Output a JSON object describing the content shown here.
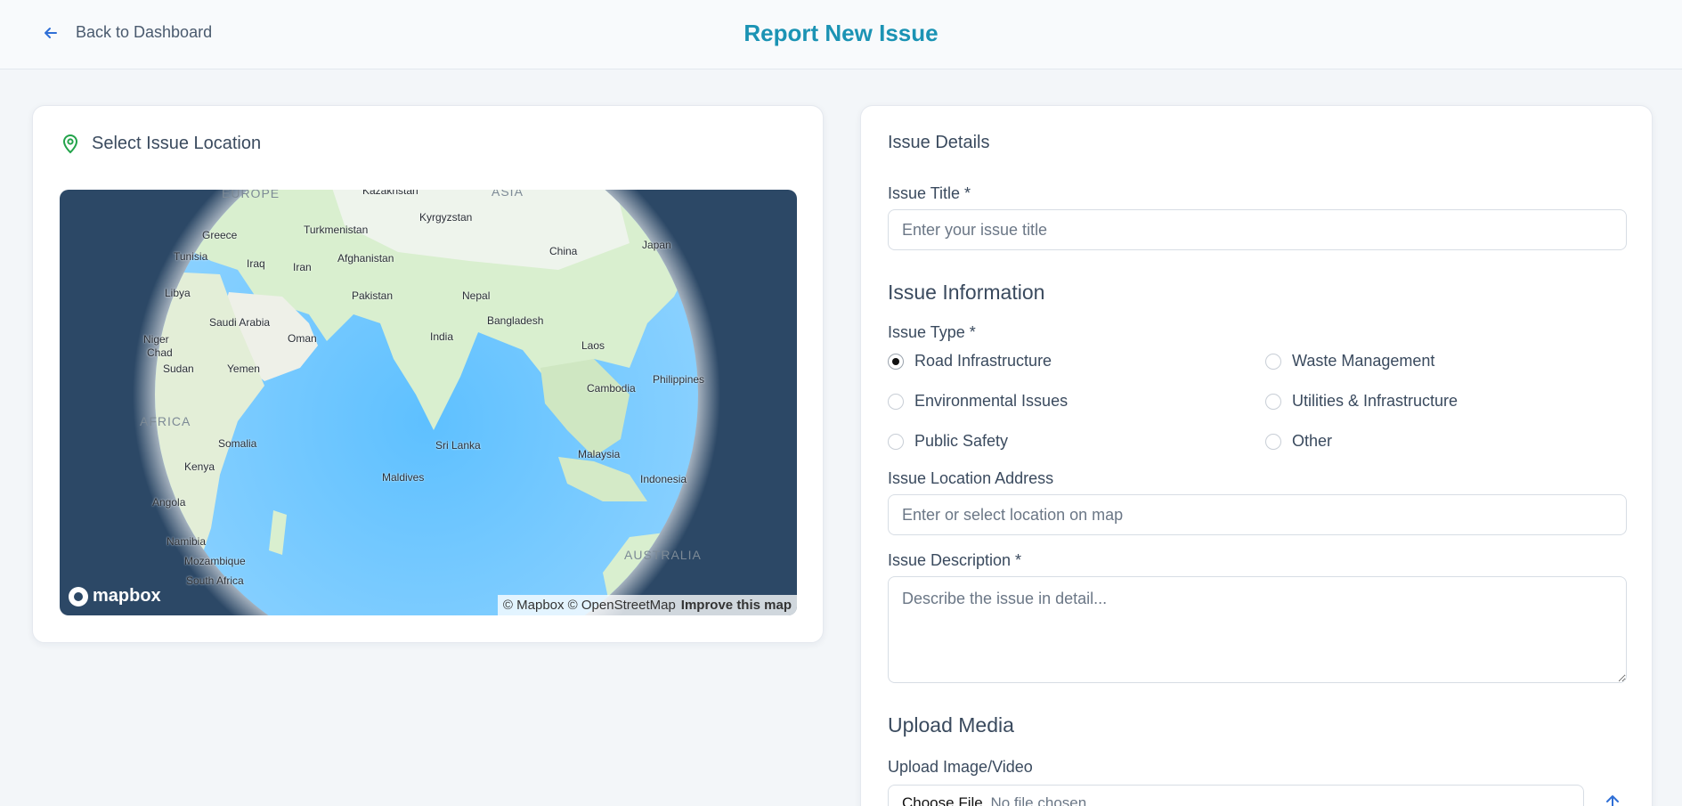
{
  "header": {
    "back_label": "Back to Dashboard",
    "title": "Report New Issue"
  },
  "map_card": {
    "title": "Select Issue Location",
    "labels": {
      "europe": "EUROPE",
      "asia": "ASIA",
      "kazakhstan": "Kazakhstan",
      "kyrgyzstan": "Kyrgyzstan",
      "greece": "Greece",
      "turkmenistan": "Turkmenistan",
      "tunisia": "Tunisia",
      "iraq": "Iraq",
      "iran": "Iran",
      "afghanistan": "Afghanistan",
      "china": "China",
      "japan": "Japan",
      "libya": "Libya",
      "pakistan": "Pakistan",
      "nepal": "Nepal",
      "saudi_arabia": "Saudi Arabia",
      "bangladesh": "Bangladesh",
      "niger": "Niger",
      "oman": "Oman",
      "india": "India",
      "chad": "Chad",
      "laos": "Laos",
      "sudan": "Sudan",
      "yemen": "Yemen",
      "philippines": "Philippines",
      "cambodia": "Cambodia",
      "africa": "AFRICA",
      "somalia": "Somalia",
      "sri_lanka": "Sri Lanka",
      "malaysia": "Malaysia",
      "kenya": "Kenya",
      "maldives": "Maldives",
      "indonesia": "Indonesia",
      "angola": "Angola",
      "namibia": "Namibia",
      "australia": "AUSTRALIA",
      "mozambique": "Mozambique",
      "south_africa": "South Africa"
    },
    "brand": "mapbox",
    "attribution": "© Mapbox © OpenStreetMap",
    "improve_link": "Improve this map"
  },
  "form": {
    "section_details": "Issue Details",
    "title_label": "Issue Title *",
    "title_placeholder": "Enter your issue title",
    "section_info": "Issue Information",
    "type_label": "Issue Type *",
    "types": [
      {
        "label": "Road Infrastructure",
        "checked": true
      },
      {
        "label": "Waste Management",
        "checked": false
      },
      {
        "label": "Environmental Issues",
        "checked": false
      },
      {
        "label": "Utilities & Infrastructure",
        "checked": false
      },
      {
        "label": "Public Safety",
        "checked": false
      },
      {
        "label": "Other",
        "checked": false
      }
    ],
    "address_label": "Issue Location Address",
    "address_placeholder": "Enter or select location on map",
    "description_label": "Issue Description *",
    "description_placeholder": "Describe the issue in detail...",
    "section_media": "Upload Media",
    "upload_label": "Upload Image/Video",
    "choose_file": "Choose File",
    "no_file": "No file chosen"
  }
}
